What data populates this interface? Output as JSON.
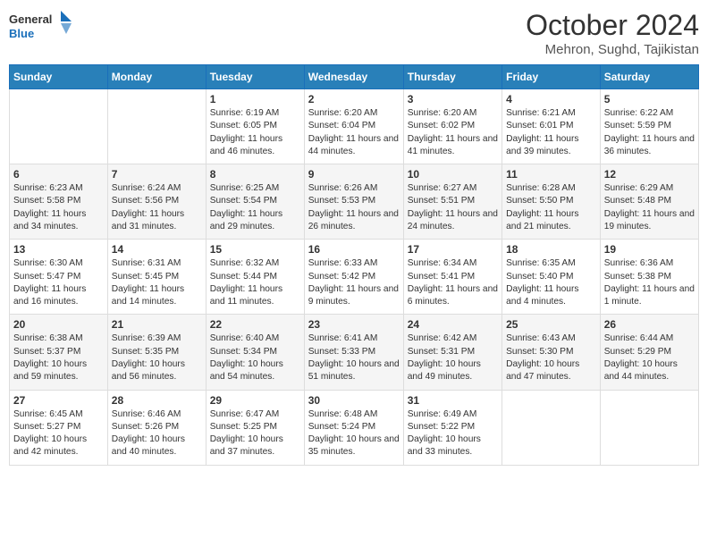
{
  "header": {
    "logo_line1": "General",
    "logo_line2": "Blue",
    "month": "October 2024",
    "location": "Mehron, Sughd, Tajikistan"
  },
  "days_of_week": [
    "Sunday",
    "Monday",
    "Tuesday",
    "Wednesday",
    "Thursday",
    "Friday",
    "Saturday"
  ],
  "weeks": [
    [
      {
        "day": null
      },
      {
        "day": null
      },
      {
        "day": 1,
        "sunrise": "6:19 AM",
        "sunset": "6:05 PM",
        "daylight": "11 hours and 46 minutes."
      },
      {
        "day": 2,
        "sunrise": "6:20 AM",
        "sunset": "6:04 PM",
        "daylight": "11 hours and 44 minutes."
      },
      {
        "day": 3,
        "sunrise": "6:20 AM",
        "sunset": "6:02 PM",
        "daylight": "11 hours and 41 minutes."
      },
      {
        "day": 4,
        "sunrise": "6:21 AM",
        "sunset": "6:01 PM",
        "daylight": "11 hours and 39 minutes."
      },
      {
        "day": 5,
        "sunrise": "6:22 AM",
        "sunset": "5:59 PM",
        "daylight": "11 hours and 36 minutes."
      }
    ],
    [
      {
        "day": 6,
        "sunrise": "6:23 AM",
        "sunset": "5:58 PM",
        "daylight": "11 hours and 34 minutes."
      },
      {
        "day": 7,
        "sunrise": "6:24 AM",
        "sunset": "5:56 PM",
        "daylight": "11 hours and 31 minutes."
      },
      {
        "day": 8,
        "sunrise": "6:25 AM",
        "sunset": "5:54 PM",
        "daylight": "11 hours and 29 minutes."
      },
      {
        "day": 9,
        "sunrise": "6:26 AM",
        "sunset": "5:53 PM",
        "daylight": "11 hours and 26 minutes."
      },
      {
        "day": 10,
        "sunrise": "6:27 AM",
        "sunset": "5:51 PM",
        "daylight": "11 hours and 24 minutes."
      },
      {
        "day": 11,
        "sunrise": "6:28 AM",
        "sunset": "5:50 PM",
        "daylight": "11 hours and 21 minutes."
      },
      {
        "day": 12,
        "sunrise": "6:29 AM",
        "sunset": "5:48 PM",
        "daylight": "11 hours and 19 minutes."
      }
    ],
    [
      {
        "day": 13,
        "sunrise": "6:30 AM",
        "sunset": "5:47 PM",
        "daylight": "11 hours and 16 minutes."
      },
      {
        "day": 14,
        "sunrise": "6:31 AM",
        "sunset": "5:45 PM",
        "daylight": "11 hours and 14 minutes."
      },
      {
        "day": 15,
        "sunrise": "6:32 AM",
        "sunset": "5:44 PM",
        "daylight": "11 hours and 11 minutes."
      },
      {
        "day": 16,
        "sunrise": "6:33 AM",
        "sunset": "5:42 PM",
        "daylight": "11 hours and 9 minutes."
      },
      {
        "day": 17,
        "sunrise": "6:34 AM",
        "sunset": "5:41 PM",
        "daylight": "11 hours and 6 minutes."
      },
      {
        "day": 18,
        "sunrise": "6:35 AM",
        "sunset": "5:40 PM",
        "daylight": "11 hours and 4 minutes."
      },
      {
        "day": 19,
        "sunrise": "6:36 AM",
        "sunset": "5:38 PM",
        "daylight": "11 hours and 1 minute."
      }
    ],
    [
      {
        "day": 20,
        "sunrise": "6:38 AM",
        "sunset": "5:37 PM",
        "daylight": "10 hours and 59 minutes."
      },
      {
        "day": 21,
        "sunrise": "6:39 AM",
        "sunset": "5:35 PM",
        "daylight": "10 hours and 56 minutes."
      },
      {
        "day": 22,
        "sunrise": "6:40 AM",
        "sunset": "5:34 PM",
        "daylight": "10 hours and 54 minutes."
      },
      {
        "day": 23,
        "sunrise": "6:41 AM",
        "sunset": "5:33 PM",
        "daylight": "10 hours and 51 minutes."
      },
      {
        "day": 24,
        "sunrise": "6:42 AM",
        "sunset": "5:31 PM",
        "daylight": "10 hours and 49 minutes."
      },
      {
        "day": 25,
        "sunrise": "6:43 AM",
        "sunset": "5:30 PM",
        "daylight": "10 hours and 47 minutes."
      },
      {
        "day": 26,
        "sunrise": "6:44 AM",
        "sunset": "5:29 PM",
        "daylight": "10 hours and 44 minutes."
      }
    ],
    [
      {
        "day": 27,
        "sunrise": "6:45 AM",
        "sunset": "5:27 PM",
        "daylight": "10 hours and 42 minutes."
      },
      {
        "day": 28,
        "sunrise": "6:46 AM",
        "sunset": "5:26 PM",
        "daylight": "10 hours and 40 minutes."
      },
      {
        "day": 29,
        "sunrise": "6:47 AM",
        "sunset": "5:25 PM",
        "daylight": "10 hours and 37 minutes."
      },
      {
        "day": 30,
        "sunrise": "6:48 AM",
        "sunset": "5:24 PM",
        "daylight": "10 hours and 35 minutes."
      },
      {
        "day": 31,
        "sunrise": "6:49 AM",
        "sunset": "5:22 PM",
        "daylight": "10 hours and 33 minutes."
      },
      {
        "day": null
      },
      {
        "day": null
      }
    ]
  ],
  "labels": {
    "sunrise": "Sunrise:",
    "sunset": "Sunset:",
    "daylight": "Daylight:"
  }
}
